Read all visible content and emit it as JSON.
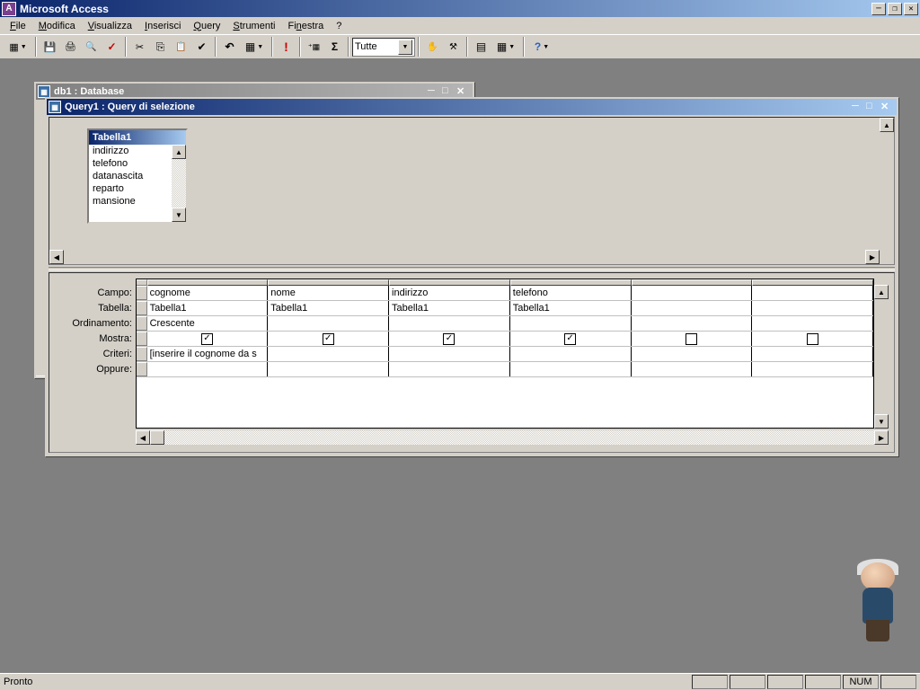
{
  "app": {
    "title": "Microsoft Access"
  },
  "menu": {
    "file": "File",
    "modifica": "Modifica",
    "visualizza": "Visualizza",
    "inserisci": "Inserisci",
    "query": "Query",
    "strumenti": "Strumenti",
    "finestra": "Finestra",
    "help": "?"
  },
  "toolbar": {
    "combo_value": "Tutte"
  },
  "db_window": {
    "title": "db1 : Database"
  },
  "query_window": {
    "title": "Query1 : Query di selezione",
    "table_box": {
      "name": "Tabella1",
      "fields": [
        "indirizzo",
        "telefono",
        "datanascita",
        "reparto",
        "mansione"
      ]
    },
    "grid": {
      "row_labels": {
        "campo": "Campo:",
        "tabella": "Tabella:",
        "ordinamento": "Ordinamento:",
        "mostra": "Mostra:",
        "criteri": "Criteri:",
        "oppure": "Oppure:"
      },
      "columns": [
        {
          "campo": "cognome",
          "tabella": "Tabella1",
          "ordinamento": "Crescente",
          "mostra": true,
          "criteri": "[inserire il cognome da s"
        },
        {
          "campo": "nome",
          "tabella": "Tabella1",
          "ordinamento": "",
          "mostra": true,
          "criteri": ""
        },
        {
          "campo": "indirizzo",
          "tabella": "Tabella1",
          "ordinamento": "",
          "mostra": true,
          "criteri": ""
        },
        {
          "campo": "telefono",
          "tabella": "Tabella1",
          "ordinamento": "",
          "mostra": true,
          "criteri": ""
        },
        {
          "campo": "",
          "tabella": "",
          "ordinamento": "",
          "mostra": false,
          "criteri": ""
        },
        {
          "campo": "",
          "tabella": "",
          "ordinamento": "",
          "mostra": false,
          "criteri": ""
        }
      ]
    }
  },
  "statusbar": {
    "status": "Pronto",
    "numlock": "NUM"
  }
}
